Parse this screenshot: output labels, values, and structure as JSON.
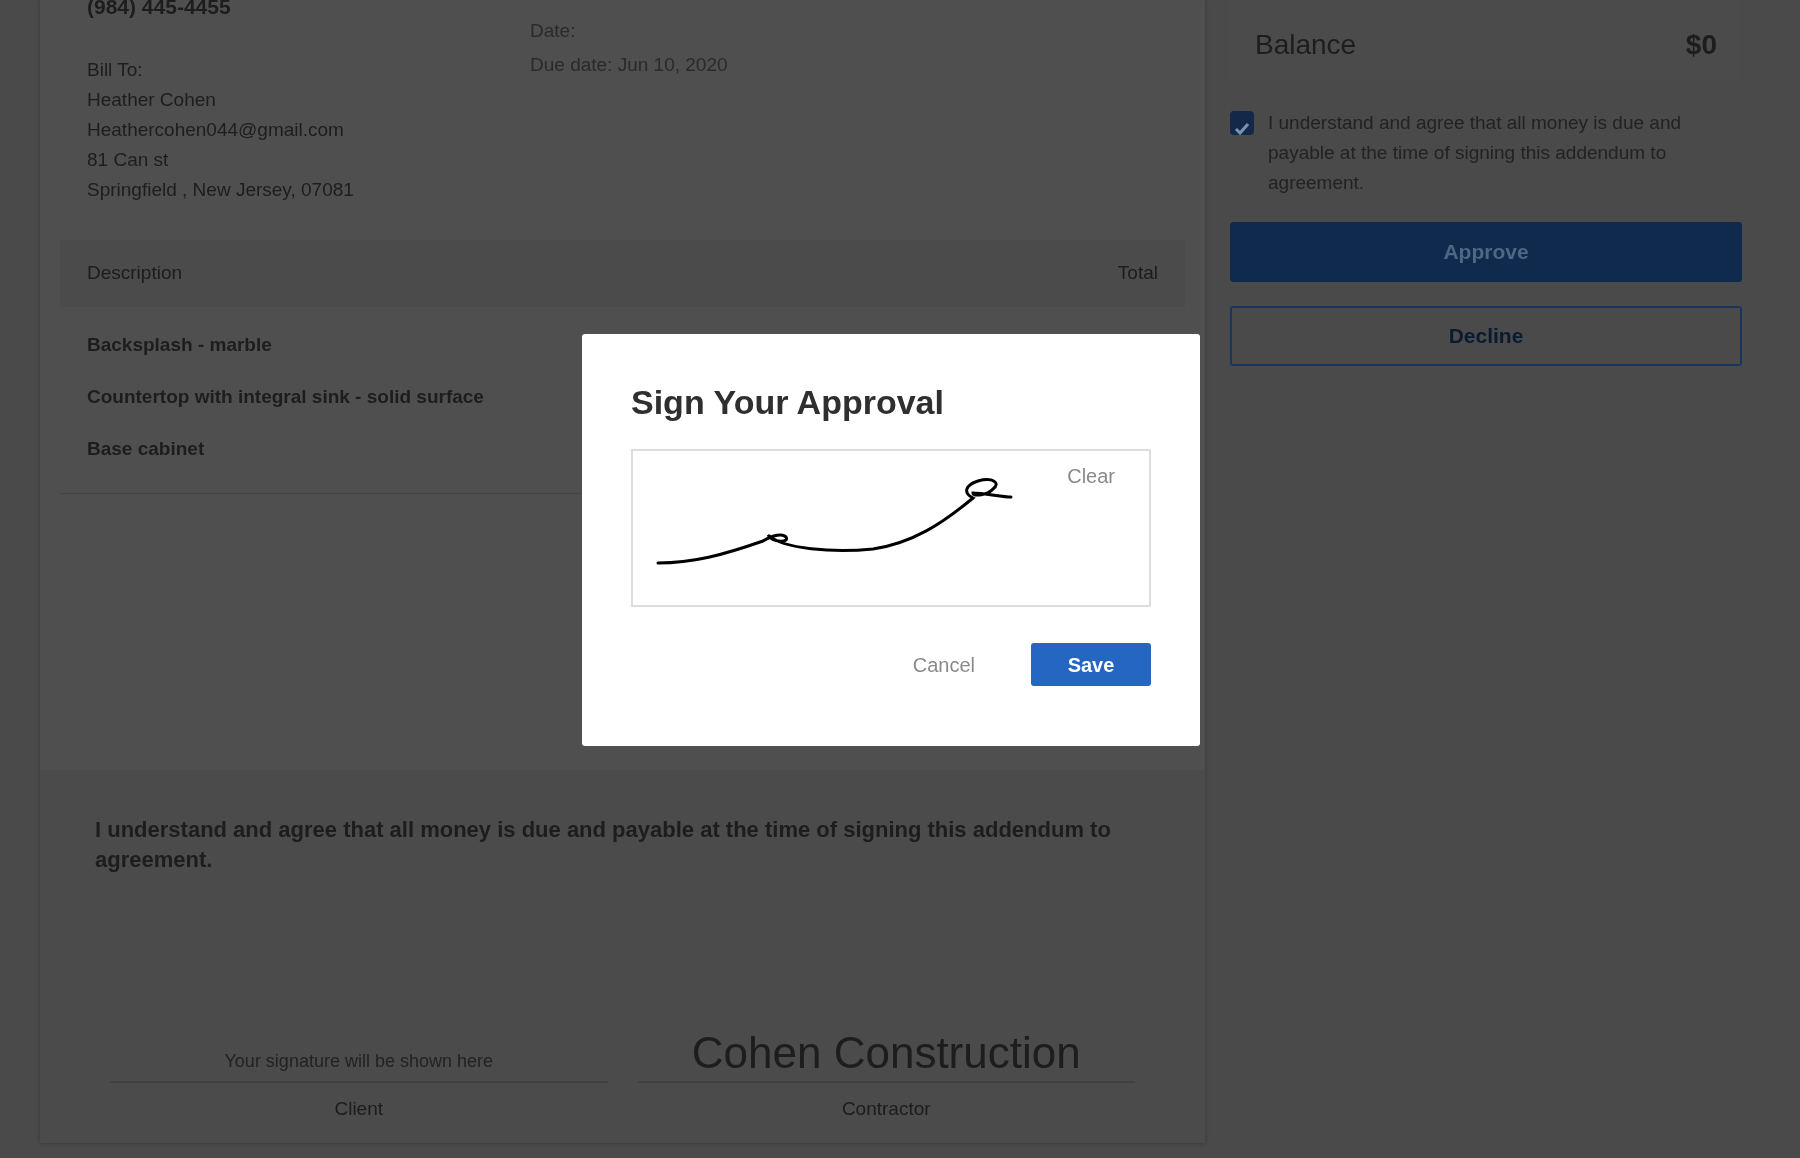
{
  "contact": {
    "phone": "(984) 445-4455",
    "bill_to": [
      "Bill To:",
      "Heather Cohen",
      "Heathercohen044@gmail.com",
      "81 Can st",
      "Springfield , New Jersey, 07081"
    ]
  },
  "dates": [
    "Date:",
    "Due date: Jun 10, 2020"
  ],
  "table": {
    "columns": [
      "Description",
      "Total"
    ],
    "rows": [
      {
        "description": "Backsplash - marble"
      },
      {
        "description": "Countertop with integral sink - solid surface"
      },
      {
        "description": "Base cabinet"
      }
    ]
  },
  "agreement": {
    "text": "I understand and agree that all money is due and payable at the time of signing this addendum to agreement.",
    "signatures": [
      {
        "kind": "hint",
        "text": "Your signature will be shown here",
        "label": "Client"
      },
      {
        "kind": "name",
        "text": "Cohen Construction",
        "label": "Contractor"
      }
    ]
  },
  "summary": {
    "balance_label": "Balance",
    "balance": "$0",
    "consent": {
      "text": "I understand and agree that all money is due and payable at the time of signing this addendum to agreement.",
      "checked": true
    },
    "buttons": [
      {
        "label": "Approve",
        "kind": "primary"
      },
      {
        "label": "Decline",
        "kind": "outline"
      }
    ]
  },
  "modal": {
    "title": "Sign Your Approval",
    "clear": "Clear",
    "buttons": [
      {
        "label": "Cancel",
        "kind": "link"
      },
      {
        "label": "Save",
        "kind": "primary"
      }
    ]
  }
}
